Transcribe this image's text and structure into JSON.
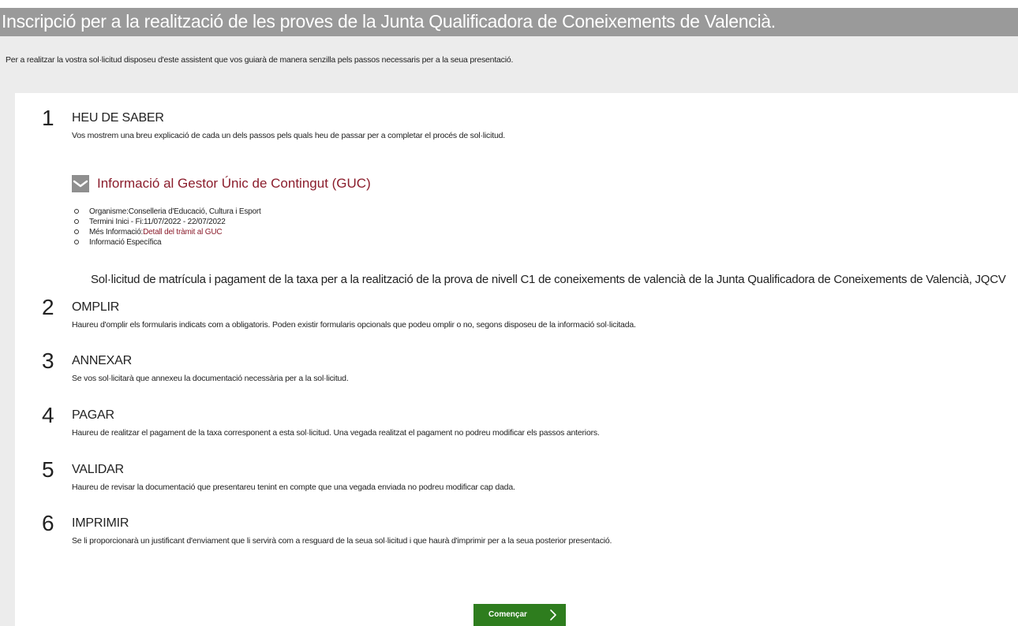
{
  "header": {
    "title": "Inscripció per a la realització de les proves de la Junta Qualificadora de Coneixements de Valencià."
  },
  "intro": {
    "heading": "Heu de saber",
    "text": "Per a realitzar la vostra sol·licitud disposeu d'este assistent que vos guiarà de manera senzilla pels passos necessaris per a la seua presentació."
  },
  "steps": [
    {
      "number": "1",
      "title": "HEU DE SABER",
      "description": "Vos mostrem una breu explicació de cada un dels passos pels quals heu de passar per a completar el procés de sol·licitud."
    },
    {
      "number": "2",
      "title": "OMPLIR",
      "description": "Haureu d'omplir els formularis indicats com a obligatoris. Poden existir formularis opcionals que podeu omplir o no, segons disposeu de la informació sol·licitada."
    },
    {
      "number": "3",
      "title": "ANNEXAR",
      "description": "Se vos sol·licitarà que annexeu la documentació necessària per a la sol·licitud."
    },
    {
      "number": "4",
      "title": "PAGAR",
      "description": "Haureu de realitzar el pagament de la taxa corresponent a esta sol·licitud. Una vegada realitzat el pagament no podreu modificar els passos anteriors."
    },
    {
      "number": "5",
      "title": "VALIDAR",
      "description": "Haureu de revisar la documentació que presentareu tenint en compte que una vegada enviada no podreu modificar cap dada."
    },
    {
      "number": "6",
      "title": "IMPRIMIR",
      "description": "Se li proporcionarà un justificant d'enviament que li servirà com a resguard de la seua sol·licitud i que haurà d'imprimir per a la seua posterior presentació."
    }
  ],
  "guc": {
    "toggle_label": "Informació al Gestor Únic de Contingut (GUC)",
    "icon": "chevron-down-icon",
    "organisme_label": "Organisme:",
    "organisme_value": "Conselleria d'Educació, Cultura i Esport",
    "termini_label": "Termini Inici - Fi:",
    "termini_value": "11/07/2022 - 22/07/2022",
    "mes_info_label": "Més Informació:",
    "mes_info_link": "Detall del tràmit al GUC",
    "especifica_label": "Informació Específica",
    "especifica_text": "Sol·licitud de matrícula i pagament de la taxa per a la realització de la prova de nivell C1 de coneixements de valencià de la Junta Qualificadora de Coneixements de Valencià, JQCV"
  },
  "actions": {
    "start_label": "Començar",
    "start_icon": "chevron-right-icon"
  },
  "colors": {
    "title_bar": "#9a9a9a",
    "background": "#ececec",
    "link": "#8b1d2c",
    "button": "#2e7d1e"
  }
}
